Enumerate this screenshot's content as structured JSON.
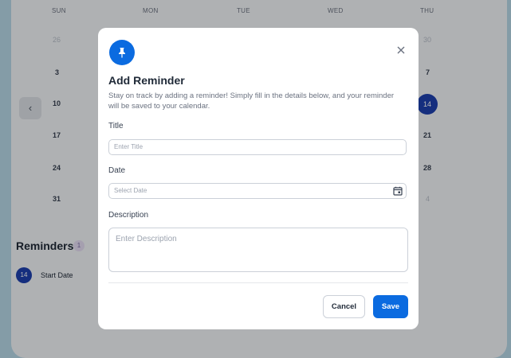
{
  "calendar": {
    "day_names": [
      "SUN",
      "MON",
      "TUE",
      "WED",
      "THU"
    ],
    "sun_dates": [
      "26",
      "3",
      "10",
      "17",
      "24",
      "31"
    ],
    "thu_dates": [
      "30",
      "7",
      "14",
      "21",
      "28",
      "4"
    ],
    "today": "14",
    "prev_icon": "chevron-left-icon"
  },
  "reminders": {
    "title": "Reminders",
    "count": "1",
    "items": [
      {
        "date": "14",
        "label": "Start Date"
      }
    ]
  },
  "modal": {
    "icon": "pin-icon",
    "title": "Add Reminder",
    "description": "Stay on track by adding a reminder! Simply fill in the details below, and your reminder will be saved to your calendar.",
    "fields": {
      "title_label": "Title",
      "title_placeholder": "Enter Title",
      "date_label": "Date",
      "date_placeholder": "Select Date",
      "description_label": "Description",
      "description_placeholder": "Enter Description"
    },
    "cancel_label": "Cancel",
    "save_label": "Save"
  },
  "colors": {
    "accent": "#0b6be0",
    "today": "#1e40af",
    "background": "#b7d8e8"
  }
}
